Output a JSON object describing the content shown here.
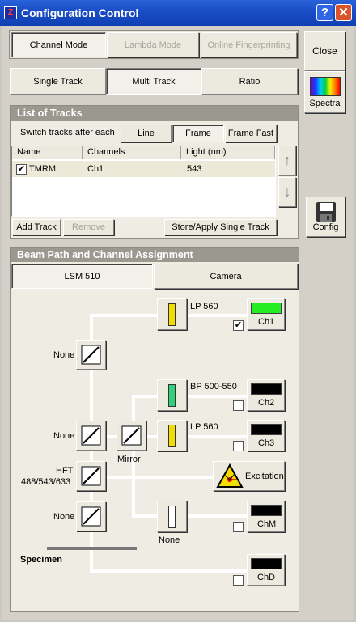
{
  "window": {
    "title": "Configuration Control",
    "help_glyph": "?",
    "close_glyph": "✕"
  },
  "mode_tabs": [
    "Channel Mode",
    "Lambda Mode",
    "Online Fingerprinting"
  ],
  "buttons": {
    "close": "Close",
    "spectra": "Spectra",
    "config": "Config"
  },
  "track_tabs": [
    "Single Track",
    "Multi Track",
    "Ratio"
  ],
  "list_of_tracks": {
    "title": "List of Tracks",
    "switch_label": "Switch tracks after each",
    "switch_options": [
      "Line",
      "Frame",
      "Frame Fast"
    ],
    "columns": [
      "Name",
      "Channels",
      "Light (nm)"
    ],
    "rows": [
      {
        "checked": "✔",
        "name": "TMRM",
        "channels": "Ch1",
        "light": "543"
      }
    ],
    "add_track": "Add Track",
    "remove": "Remove",
    "store_apply": "Store/Apply Single Track",
    "up_arrow": "↑",
    "down_arrow": "↓"
  },
  "beam_path": {
    "title": "Beam Path and Channel Assignment",
    "tabs": [
      "LSM 510",
      "Camera"
    ],
    "labels": {
      "none_1": "None",
      "none_2": "None",
      "none_3": "None",
      "hft_1": "HFT",
      "hft_2": "488/543/633",
      "mirror": "Mirror",
      "lp560_top": "LP 560",
      "bp": "BP 500-550",
      "lp560_mid": "LP 560",
      "none_filter": "None",
      "specimen": "Specimen",
      "excitation": "Excitation"
    },
    "channels": [
      {
        "name": "Ch1",
        "checked": "✔",
        "color": "#22ee22"
      },
      {
        "name": "Ch2",
        "checked": "",
        "color": "#000000"
      },
      {
        "name": "Ch3",
        "checked": "",
        "color": "#000000"
      },
      {
        "name": "ChM",
        "checked": "",
        "color": "#000000"
      },
      {
        "name": "ChD",
        "checked": "",
        "color": "#000000"
      }
    ],
    "filter_colors": {
      "lp560_top": "#f0dc00",
      "bp": "#2fd27a",
      "lp560_mid": "#f0dc00",
      "none": "#ffffff"
    }
  }
}
